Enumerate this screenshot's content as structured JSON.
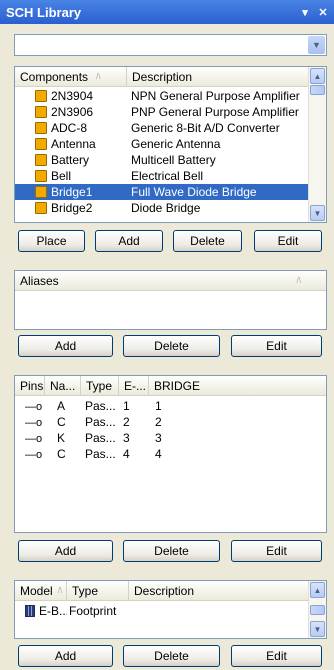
{
  "window": {
    "title": "SCH Library",
    "menu_glyph": "▾",
    "close_glyph": "✕"
  },
  "filter": {
    "value": ""
  },
  "components": {
    "headers": [
      "Components",
      "Description"
    ],
    "rows": [
      {
        "name": "2N3904",
        "description": "NPN General Purpose Amplifier"
      },
      {
        "name": "2N3906",
        "description": "PNP General Purpose Amplifier"
      },
      {
        "name": "ADC-8",
        "description": "Generic 8-Bit A/D Converter"
      },
      {
        "name": "Antenna",
        "description": "Generic Antenna"
      },
      {
        "name": "Battery",
        "description": "Multicell Battery"
      },
      {
        "name": "Bell",
        "description": "Electrical Bell"
      },
      {
        "name": "Bridge1",
        "description": "Full Wave Diode Bridge"
      },
      {
        "name": "Bridge2",
        "description": "Diode Bridge"
      }
    ],
    "selected_index": 6,
    "buttons": [
      "Place",
      "Add",
      "Delete",
      "Edit"
    ]
  },
  "aliases": {
    "header": "Aliases",
    "buttons": [
      "Add",
      "Delete",
      "Edit"
    ]
  },
  "pins": {
    "headers": [
      "Pins",
      "Na...",
      "Type",
      "E-...",
      "BRIDGE"
    ],
    "rows": [
      {
        "name": "A",
        "type": "Pas...",
        "e": "1",
        "bridge": "1"
      },
      {
        "name": "C",
        "type": "Pas...",
        "e": "2",
        "bridge": "2"
      },
      {
        "name": "K",
        "type": "Pas...",
        "e": "3",
        "bridge": "3"
      },
      {
        "name": "C",
        "type": "Pas...",
        "e": "4",
        "bridge": "4"
      }
    ],
    "pin_glyph": "—o",
    "buttons": [
      "Add",
      "Delete",
      "Edit"
    ]
  },
  "models": {
    "headers": [
      "Model",
      "Type",
      "Description"
    ],
    "rows": [
      {
        "model": "E-B...",
        "type": "Footprint",
        "description": ""
      }
    ],
    "buttons": [
      "Add",
      "Delete",
      "Edit"
    ]
  },
  "colors": {
    "title_bar": "#2a5fd0",
    "selection": "#316ac5",
    "panel_bg": "#ece9d8"
  },
  "icons": {
    "component": "component-icon",
    "pin": "pin-icon",
    "footprint": "footprint-icon"
  }
}
